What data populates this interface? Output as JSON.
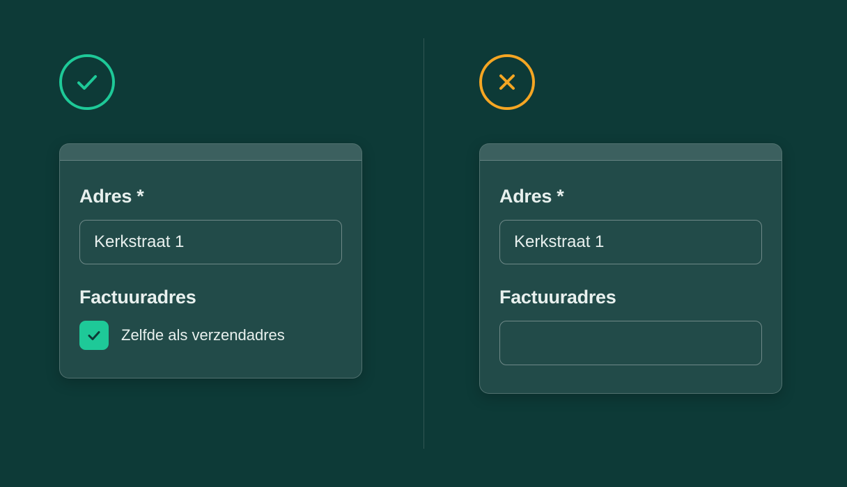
{
  "colors": {
    "success": "#1ec998",
    "error": "#f5a623"
  },
  "left": {
    "status": "success",
    "address": {
      "label": "Adres *",
      "value": "Kerkstraat 1"
    },
    "billing": {
      "label": "Factuuradres",
      "checkbox_label": "Zelfde als verzendadres",
      "checkbox_checked": true
    }
  },
  "right": {
    "status": "error",
    "address": {
      "label": "Adres *",
      "value": "Kerkstraat 1"
    },
    "billing": {
      "label": "Factuuradres",
      "value": ""
    }
  }
}
